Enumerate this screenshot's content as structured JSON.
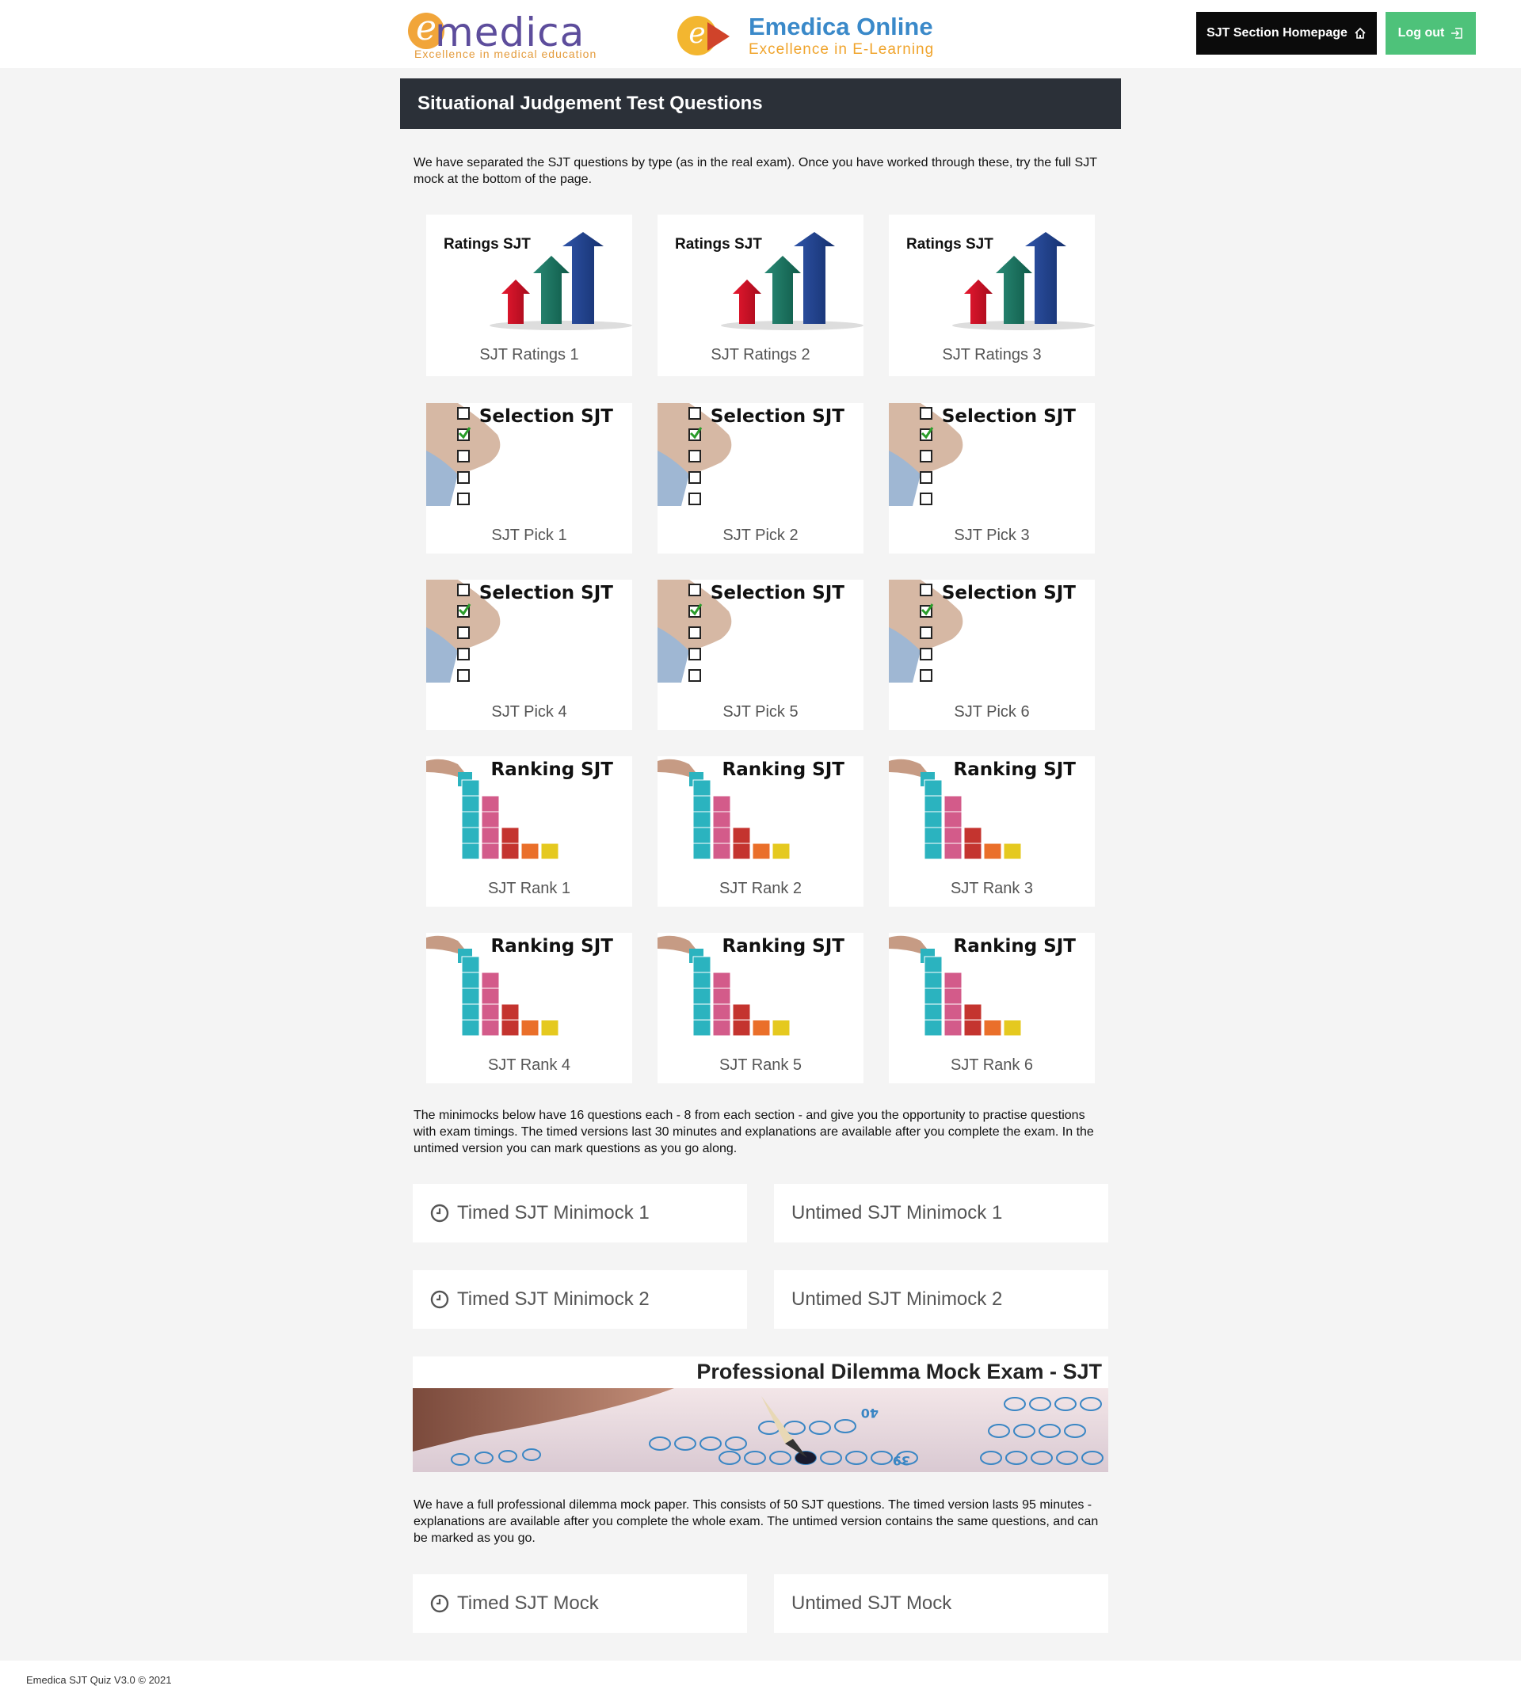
{
  "header": {
    "logo_left_name": "medica",
    "logo_left_letter": "e",
    "logo_left_tagline": "Excellence in medical education",
    "logo_right_letter": "e",
    "logo_right_name": "Emedica Online",
    "logo_right_tagline": "Excellence in E-Learning",
    "home_button": "SJT Section Homepage",
    "logout_button": "Log out"
  },
  "page_title": "Situational Judgement Test Questions",
  "intro": "We have separated the SJT questions by type (as in the real exam). Once you have worked through these, try the full SJT mock at the bottom of the page.",
  "cards": [
    {
      "art_title": "Ratings SJT",
      "label": "SJT Ratings 1"
    },
    {
      "art_title": "Ratings SJT",
      "label": "SJT Ratings 2"
    },
    {
      "art_title": "Ratings SJT",
      "label": "SJT Ratings 3"
    },
    {
      "art_title": "Selection SJT",
      "label": "SJT Pick 1"
    },
    {
      "art_title": "Selection SJT",
      "label": "SJT Pick 2"
    },
    {
      "art_title": "Selection SJT",
      "label": "SJT Pick 3"
    },
    {
      "art_title": "Selection SJT",
      "label": "SJT Pick 4"
    },
    {
      "art_title": "Selection SJT",
      "label": "SJT Pick 5"
    },
    {
      "art_title": "Selection SJT",
      "label": "SJT Pick 6"
    },
    {
      "art_title": "Ranking SJT",
      "label": "SJT Rank 1"
    },
    {
      "art_title": "Ranking SJT",
      "label": "SJT Rank 2"
    },
    {
      "art_title": "Ranking SJT",
      "label": "SJT Rank 3"
    },
    {
      "art_title": "Ranking SJT",
      "label": "SJT Rank 4"
    },
    {
      "art_title": "Ranking SJT",
      "label": "SJT Rank 5"
    },
    {
      "art_title": "Ranking SJT",
      "label": "SJT Rank 6"
    }
  ],
  "minimock_text": "The minimocks below have 16 questions each - 8 from each section - and give you the opportunity to practise questions with exam timings. The timed versions last 30 minutes and explanations are available after you complete the exam. In the untimed version you can mark questions as you go along.",
  "minimocks": {
    "timed_1": "Timed SJT Minimock 1",
    "untimed_1": "Untimed SJT Minimock 1",
    "timed_2": "Timed SJT Minimock 2",
    "untimed_2": "Untimed SJT Minimock 2"
  },
  "banner_title": "Professional Dilemma Mock Exam - SJT",
  "banner_numbers": [
    "40",
    "39"
  ],
  "mock_text": "We have a full professional dilemma mock paper. This consists of 50 SJT questions. The timed version lasts 95 minutes - explanations are available after you complete the whole exam. The untimed version contains the same questions, and can be marked as you go.",
  "mocks": {
    "timed": "Timed SJT Mock",
    "untimed": "Untimed SJT Mock"
  },
  "footer": "Emedica SJT Quiz V3.0 © 2021",
  "colors": {
    "title_bar": "#2b3038",
    "logout_green": "#4ec27a",
    "home_black": "#0b0b0b"
  }
}
